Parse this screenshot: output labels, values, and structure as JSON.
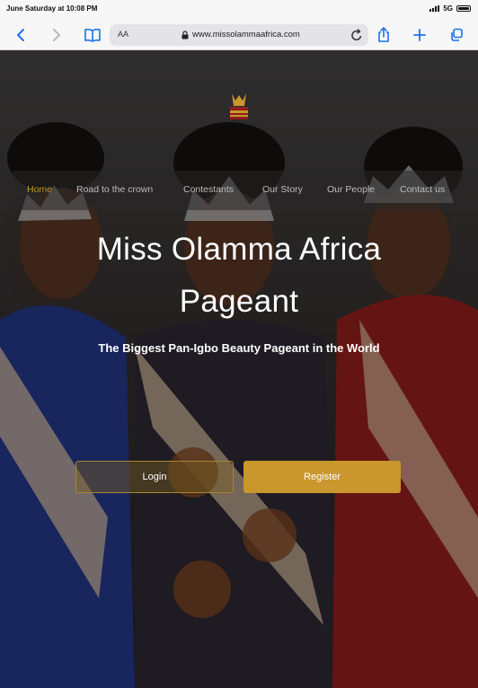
{
  "status_bar": {
    "time": "June Saturday at 10:08 PM",
    "network": "5G"
  },
  "browser": {
    "aa_label": "AA",
    "url": "www.missolammaafrica.com"
  },
  "nav": {
    "items": [
      {
        "label": "Home",
        "active": true
      },
      {
        "label": "Road to the crown"
      },
      {
        "label": "Contestants"
      },
      {
        "label": "Our Story"
      },
      {
        "label": "Our People"
      },
      {
        "label": "Contact us"
      }
    ]
  },
  "hero": {
    "title_line1": "Miss Olamma Africa",
    "title_line2": "Pageant",
    "subtitle": "The Biggest Pan-Igbo Beauty Pageant in the World"
  },
  "actions": {
    "login_label": "Login",
    "register_label": "Register"
  },
  "colors": {
    "accent": "#c9972c",
    "nav_text": "#bdbdbd",
    "toolbar_blue": "#1a73e8"
  }
}
